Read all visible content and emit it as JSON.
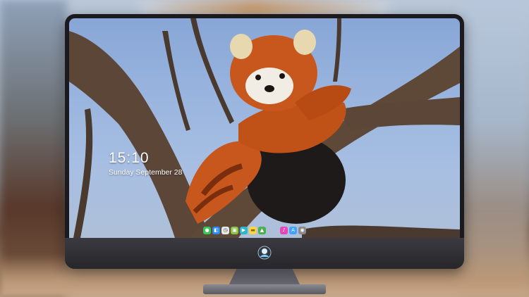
{
  "lock_screen": {
    "time": "15:10",
    "date": "Sunday September 28",
    "notes": [
      "",
      ""
    ]
  },
  "dock": {
    "items": [
      {
        "name": "messages-icon",
        "color": "#35c759",
        "glyph": "●"
      },
      {
        "name": "finder-icon",
        "color": "#2a8cf0",
        "glyph": "◧"
      },
      {
        "name": "clock-icon",
        "color": "#e8e8e8",
        "glyph": "◷"
      },
      {
        "name": "preview-icon",
        "color": "#8bc34a",
        "glyph": "▣"
      },
      {
        "name": "video-icon",
        "color": "#2fb6c8",
        "glyph": "▶"
      },
      {
        "name": "notes-icon",
        "color": "#f5d547",
        "glyph": "▬"
      },
      {
        "name": "photos-icon",
        "color": "#4caf50",
        "glyph": "▲"
      },
      {
        "name": "itunes-icon",
        "color": "#e846b8",
        "glyph": "♪"
      },
      {
        "name": "app-store-icon",
        "color": "#3ea4ff",
        "glyph": "A"
      },
      {
        "name": "camera-icon",
        "color": "#8a8a8a",
        "glyph": "◉"
      }
    ]
  },
  "colors": {
    "sky": "#9bb6df",
    "fur": "#c8571e",
    "branch": "#5b4638",
    "bezel": "#1b1b1f"
  }
}
